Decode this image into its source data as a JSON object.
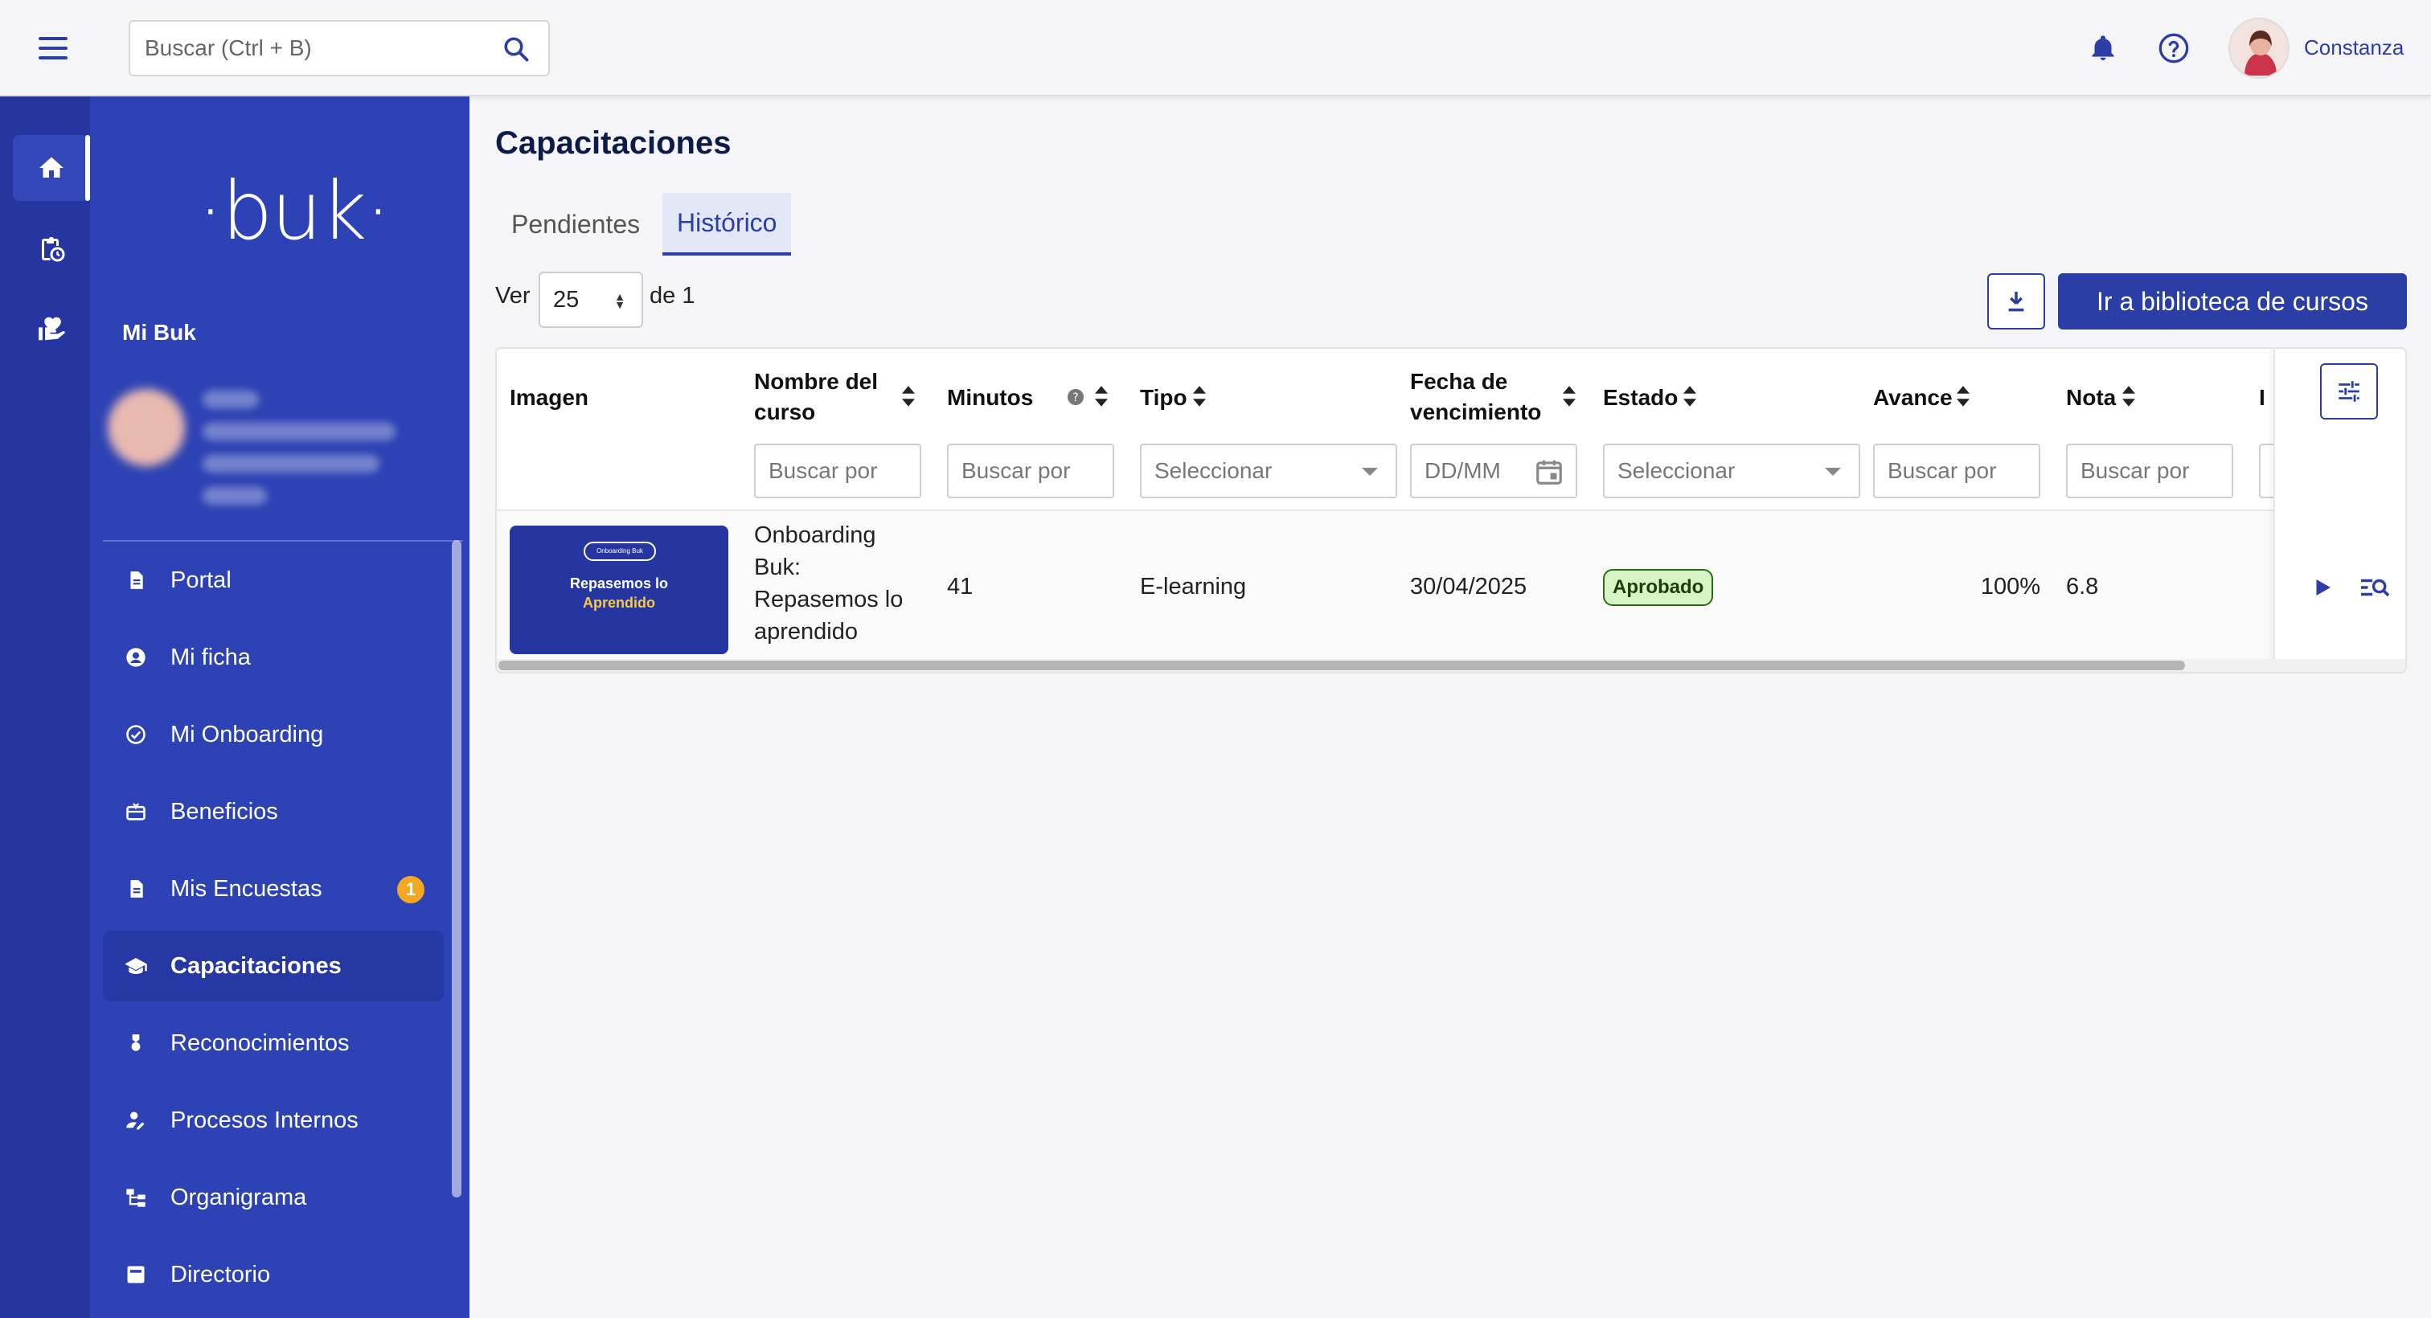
{
  "topbar": {
    "search_placeholder": "Buscar (Ctrl + B)",
    "user_name": "Constanza"
  },
  "sidebar": {
    "logo": "·buk·",
    "section_title": "Mi Buk",
    "items": [
      {
        "label": "Portal",
        "icon": "document-icon"
      },
      {
        "label": "Mi ficha",
        "icon": "account-circle-icon"
      },
      {
        "label": "Mi Onboarding",
        "icon": "check-circle-icon"
      },
      {
        "label": "Beneficios",
        "icon": "gift-card-icon"
      },
      {
        "label": "Mis Encuestas",
        "icon": "document-icon",
        "badge": "1"
      },
      {
        "label": "Capacitaciones",
        "icon": "school-icon",
        "active": true
      },
      {
        "label": "Reconocimientos",
        "icon": "medal-icon"
      },
      {
        "label": "Procesos Internos",
        "icon": "person-edit-icon"
      },
      {
        "label": "Organigrama",
        "icon": "org-chart-icon"
      },
      {
        "label": "Directorio",
        "icon": "directory-icon"
      }
    ]
  },
  "main": {
    "title": "Capacitaciones",
    "tabs": [
      {
        "label": "Pendientes"
      },
      {
        "label": "Histórico",
        "active": true
      }
    ],
    "pagination": {
      "ver_label": "Ver",
      "page_size": "25",
      "of_label": "de 1"
    },
    "library_button": "Ir a biblioteca de cursos",
    "table": {
      "headers": {
        "imagen": "Imagen",
        "nombre_1": "Nombre del",
        "nombre_2": "curso",
        "minutos": "Minutos",
        "tipo": "Tipo",
        "fecha_1": "Fecha de",
        "fecha_2": "vencimiento",
        "estado": "Estado",
        "avance": "Avance",
        "nota": "Nota",
        "extra": "I"
      },
      "filters": {
        "nombre": "Buscar por",
        "minutos": "Buscar por",
        "tipo": "Seleccionar",
        "fecha": "DD/MM",
        "estado": "Seleccionar",
        "avance": "Buscar por",
        "nota": "Buscar por"
      },
      "rows": [
        {
          "image": {
            "tag": "Onboarding Buk",
            "line1": "Repasemos lo",
            "line2": "Aprendido"
          },
          "nombre_lines": [
            "Onboarding",
            "Buk:",
            "Repasemos lo",
            "aprendido"
          ],
          "minutos": "41",
          "tipo": "E-learning",
          "fecha": "30/04/2025",
          "estado": "Aprobado",
          "avance": "100%",
          "nota": "6.8"
        }
      ]
    }
  }
}
